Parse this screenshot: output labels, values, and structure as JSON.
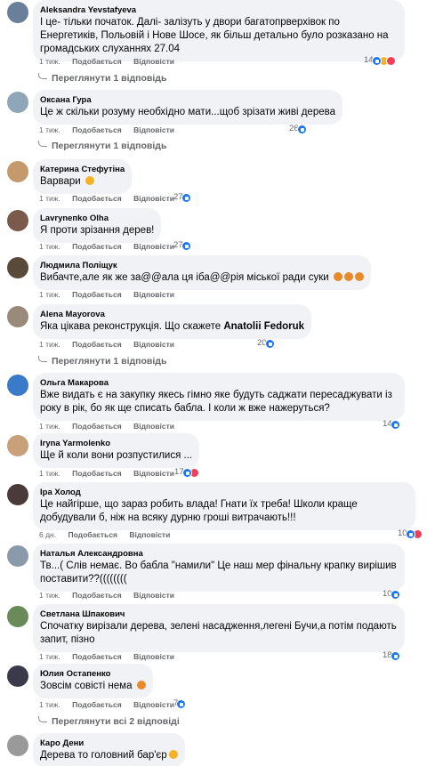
{
  "comments": [
    {
      "author": "Aleksandra Yevstafyeva",
      "text": "І це- тільки початок. Далі- залізуть у двори багатопрверхівок по Енергетиків, Польовій і Нове Шосе, як більш детально було розказано на громадських слуханнях 27.04",
      "time": "1 тиж.",
      "like": "Подобається",
      "reply": "Відповісти",
      "reactions": "14",
      "reaction_icons": [
        "like-icon",
        "haha-icon",
        "love-icon"
      ],
      "view_replies": "Переглянути 1 відповідь",
      "avatar_color": "#6a7f9a"
    },
    {
      "author": "Оксана Гура",
      "text": "Це ж скільки розуму необхідно мати...щоб зрізати живі дерева",
      "time": "1 тиж.",
      "like": "Подобається",
      "reply": "Відповісти",
      "reactions": "26",
      "reaction_icons": [
        "like-icon"
      ],
      "view_replies": "Переглянути 1 відповідь",
      "avatar_color": "#8fa6b8"
    },
    {
      "author": "Катерина Стефутіна",
      "text": "Варвари",
      "emoji": "sad-face-emoji",
      "time": "1 тиж.",
      "like": "Подобається",
      "reply": "Відповісти",
      "reactions": "27",
      "reaction_icons": [
        "like-icon"
      ],
      "avatar_color": "#c49a6c"
    },
    {
      "author": "Lavryneпko Olha",
      "text": "Я проти зрізання дерев!",
      "time": "1 тиж.",
      "like": "Подобається",
      "reply": "Відповісти",
      "reactions": "27",
      "reaction_icons": [
        "like-icon"
      ],
      "avatar_color": "#7a5a4a"
    },
    {
      "author": "Людмила Поліщук",
      "text": "Вибачте,але як же за@@ала ця іба@@рія міської ради суки",
      "emoji": "angry-face-emoji",
      "time": "1 тиж.",
      "like": "Подобається",
      "reply": "Відповісти",
      "avatar_color": "#5a4a3a"
    },
    {
      "author": "Alena Mayorova",
      "text": "Яка цікава реконструкція. Що скажете ",
      "mention": "Anatolii Fedoruk",
      "time": "1 тиж.",
      "like": "Подобається",
      "reply": "Відповісти",
      "reactions": "20",
      "reaction_icons": [
        "like-icon"
      ],
      "view_replies": "Переглянути 1 відповідь",
      "avatar_color": "#9a8a7a"
    },
    {
      "author": "Ольга Макарова",
      "text": "Вже видать є на закупку якесь гімно яке будуть саджати пересаджувати із року в рік, бо як ще списать бабла. І коли ж вже нажеруться?",
      "time": "1 тиж.",
      "like": "Подобається",
      "reply": "Відповісти",
      "reactions": "14",
      "reaction_icons": [
        "like-icon"
      ],
      "avatar_color": "#3a7ac8"
    },
    {
      "author": "Iryna Yarmolenko",
      "text": "Ще й коли вони розпустилися ...",
      "time": "1 тиж.",
      "like": "Подобається",
      "reply": "Відповісти",
      "reactions": "17",
      "reaction_icons": [
        "like-icon",
        "love-icon"
      ],
      "avatar_color": "#c8a07a"
    },
    {
      "author": "Іра Холод",
      "text": "Це найгірше, що зараз робить влада! Гнати їх треба! Школи краще добудували б, ніж на всяку дурню гроші витрачають!!!",
      "time": "6 дн.",
      "like": "Подобається",
      "reply": "Відповісти",
      "reactions": "10",
      "reaction_icons": [
        "like-icon",
        "love-icon"
      ],
      "avatar_color": "#4a3a3a"
    },
    {
      "author": "Наталья Александровна",
      "text": "Тв...( Слів немає. Во бабла \"намили\" Це наш мер фінальну крапку вирішив поставити??((((((((",
      "time": "1 тиж.",
      "like": "Подобається",
      "reply": "Відповісти",
      "reactions": "10",
      "reaction_icons": [
        "like-icon"
      ],
      "avatar_color": "#8a9aaa"
    },
    {
      "author": "Светлана Шпакович",
      "text": "Спочатку вирізали дерева, зелені насадження,легені Бучи,а потім подають запит, пізно",
      "time": "1 тиж.",
      "like": "Подобається",
      "reply": "Відповісти",
      "reactions": "18",
      "reaction_icons": [
        "like-icon"
      ],
      "avatar_color": "#6a8a5a"
    },
    {
      "author": "Юлия Остапенко",
      "text": "Зовсім совісті нема",
      "emoji": "angry-face-emoji",
      "time": "1 тиж.",
      "like": "Подобається",
      "reply": "Відповісти",
      "reactions": "7",
      "reaction_icons": [
        "like-icon"
      ],
      "view_replies": "Переглянути всі 2 відповіді",
      "avatar_color": "#3a3a4a"
    },
    {
      "author": "Каро Дени",
      "text": "Дерева то головний бар'єр",
      "emoji": "sad-face-emoji",
      "avatar_color": "#9a9a9a"
    }
  ]
}
